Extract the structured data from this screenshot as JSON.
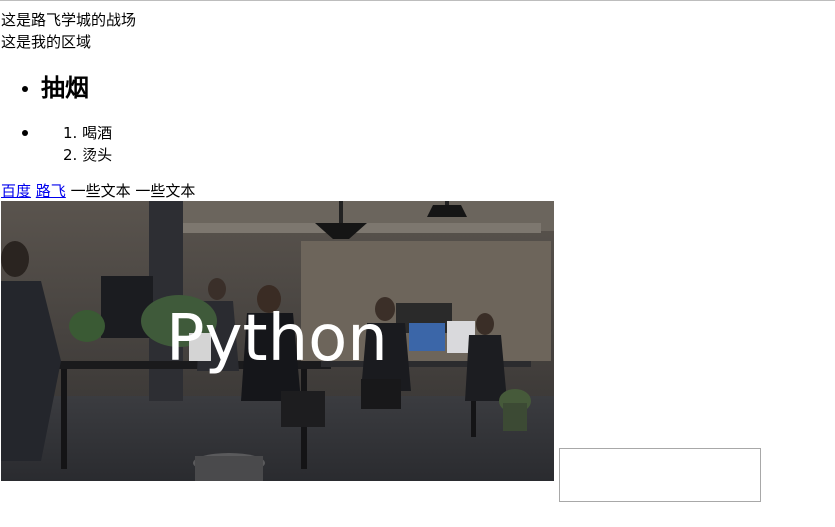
{
  "paragraph_1": "这是路飞学城的战场",
  "paragraph_2": "这是我的区域",
  "unordered_list": {
    "item_1_heading": "抽烟",
    "nested_ordered_list": [
      "喝酒",
      "烫头"
    ]
  },
  "links_row": {
    "link_1": "百度",
    "link_2": "路飞",
    "text_1": "一些文本",
    "text_2": "一些文本"
  },
  "image": {
    "description": "office",
    "overlay_text": "Python"
  },
  "text_field": {
    "value": ""
  }
}
